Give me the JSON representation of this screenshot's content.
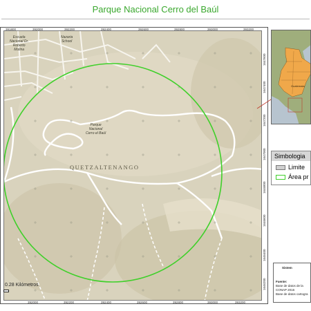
{
  "title": "Parque Nacional Cerro del Baúl",
  "map": {
    "region_label": "QUETZALTENANGO",
    "park_label": [
      "Parque",
      "Nacional",
      "Cerro el Baúl"
    ],
    "school_label": [
      "Escuela",
      "Nacional Dr.",
      "Roberto",
      "Molina"
    ],
    "school2_label": [
      "Nazaria",
      "School"
    ],
    "top_ticks": [
      "391800",
      "392000",
      "392200",
      "392400",
      "392600",
      "392800",
      "393000",
      "393200",
      "393400",
      "393600"
    ],
    "bottom_ticks": [
      "391800",
      "392000",
      "392200",
      "392400",
      "392600",
      "392800",
      "393000",
      "393200",
      "393400",
      "393600"
    ],
    "right_ticks": [
      "1647600",
      "1647400",
      "1647200",
      "1647000",
      "1646800",
      "1646600",
      "1646400",
      "1646200",
      "1646000"
    ],
    "colors": {
      "terrain": "#d9d3bd",
      "protected_area": "#3fd02a",
      "roads": "#ffffff",
      "limit": "#c0392b"
    }
  },
  "inset": {
    "label": "Guatemala",
    "colors": {
      "country": "#f0a84a",
      "land": "#9fae7c",
      "sea": "#b7c4cf"
    }
  },
  "legend": {
    "header": "Simbologia",
    "items": [
      {
        "label": "Limite",
        "color": "#d0d0d0"
      },
      {
        "label": "Área pr",
        "color": "#3fd02a"
      }
    ]
  },
  "info": {
    "title": "Sistem",
    "lines": [
      "Fuente:",
      "Base de datos de la",
      "CONAP 2016",
      "Base de datos cartogra"
    ]
  },
  "scale": {
    "label": "0.28 Kilómetros"
  }
}
